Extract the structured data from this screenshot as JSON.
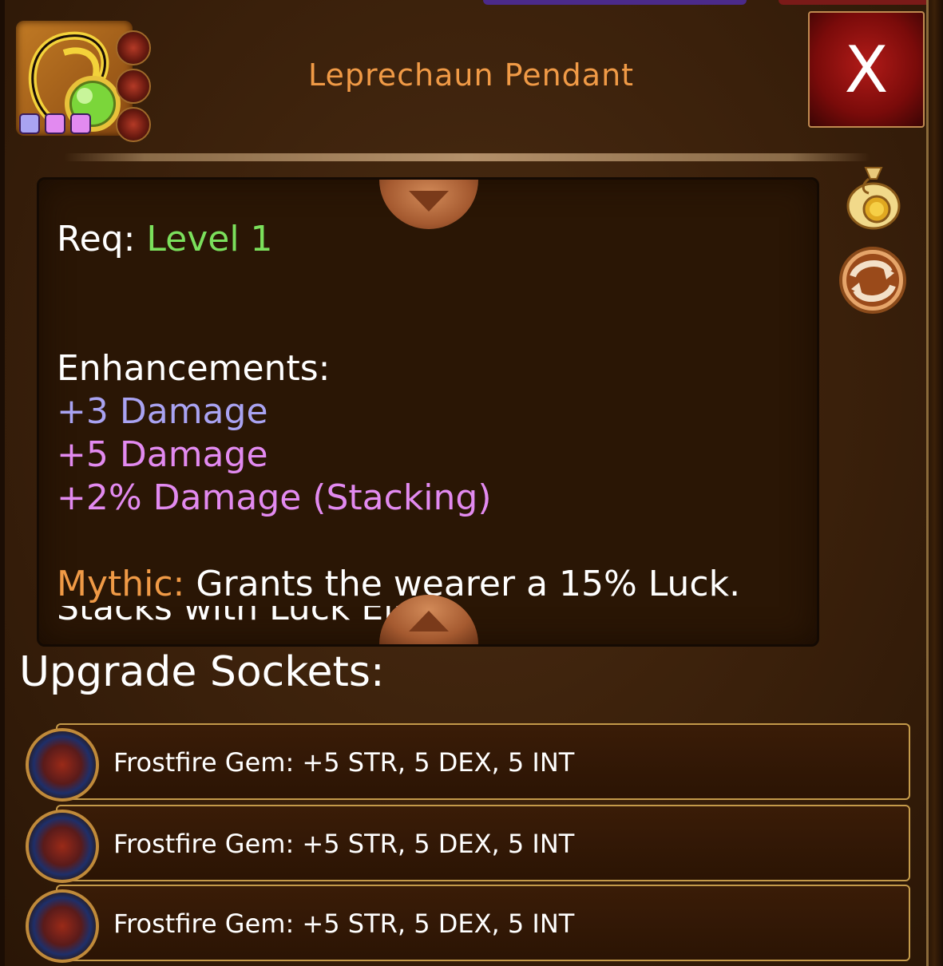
{
  "item": {
    "title": "Leprechaun Pendant",
    "tier_colors": [
      "#a9a3f2",
      "#e28af0",
      "#e28af0"
    ]
  },
  "close_button": {
    "label": "X"
  },
  "description": {
    "req_label": "Req:",
    "req_value": "Level 1",
    "enhancements_heading": "Enhancements:",
    "enhancements": [
      {
        "text": "+3 Damage",
        "color": "#a9a3f2"
      },
      {
        "text": "+5 Damage",
        "color": "#e28af0"
      },
      {
        "text": "+2% Damage (Stacking)",
        "color": "#e28af0"
      }
    ],
    "mythic_label": "Mythic:",
    "mythic_text": "Grants the wearer a 15% Luck.",
    "mythic_next_line": "Stacks with Luck Elixir."
  },
  "upgrade_sockets": {
    "heading": "Upgrade Sockets:",
    "rows": [
      "Frostfire Gem: +5 STR, 5 DEX, 5 INT",
      "Frostfire Gem: +5 STR, 5 DEX, 5 INT",
      "Frostfire Gem: +5 STR, 5 DEX, 5 INT"
    ]
  },
  "colors": {
    "title": "#f09a46",
    "req_value": "#7be05c",
    "mythic_label": "#f09a46",
    "text": "#ffffff"
  }
}
